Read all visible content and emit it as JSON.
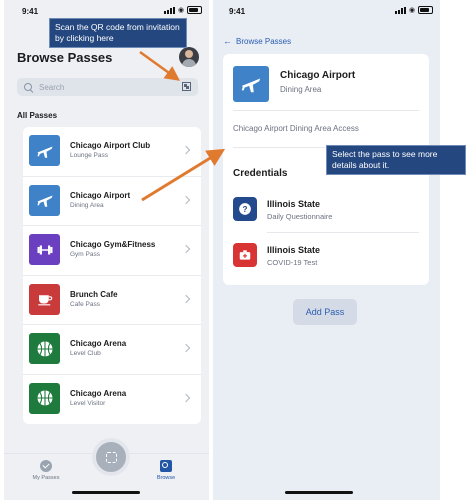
{
  "status": {
    "time": "9:41"
  },
  "annotations": {
    "scan_hint": "Scan the QR code from invitation by clicking here",
    "select_hint": "Select the pass to see more details about it."
  },
  "left": {
    "title": "Browse Passes",
    "search": {
      "placeholder": "Search"
    },
    "section_label": "All Passes",
    "passes": [
      {
        "name": "Chicago Airport Club",
        "sub": "Lounge Pass",
        "icon": "airplane-icon",
        "color": "#3f82c8"
      },
      {
        "name": "Chicago Airport",
        "sub": "Dining Area",
        "icon": "airplane-icon",
        "color": "#3f82c8"
      },
      {
        "name": "Chicago Gym&Fitness",
        "sub": "Gym Pass",
        "icon": "dumbbell-icon",
        "color": "#6a3fc0"
      },
      {
        "name": "Brunch Cafe",
        "sub": "Cafe Pass",
        "icon": "coffee-cup-icon",
        "color": "#c93a3a"
      },
      {
        "name": "Chicago Arena",
        "sub": "Level Club",
        "icon": "basketball-icon",
        "color": "#1f7a3d"
      },
      {
        "name": "Chicago Arena",
        "sub": "Level Visitor",
        "icon": "basketball-icon",
        "color": "#1f7a3d"
      }
    ],
    "tabs": {
      "my_passes": "My Passes",
      "browse": "Browse"
    }
  },
  "right": {
    "back_label": "Browse Passes",
    "detail": {
      "name": "Chicago Airport",
      "sub": "Dining Area",
      "icon": "airplane-icon",
      "color": "#3f82c8"
    },
    "access_title": "Chicago Airport Dining Area Access",
    "credentials_title": "Credentials",
    "credentials": [
      {
        "name": "Illinois State",
        "sub": "Daily Questionnaire",
        "icon": "question-icon",
        "color": "#234a8c"
      },
      {
        "name": "Illinois State",
        "sub": "COVID-19 Test",
        "icon": "medical-kit-icon",
        "color": "#d93434"
      }
    ],
    "add_pass_label": "Add Pass"
  },
  "colors": {
    "accent": "#2a5db0",
    "callout": "#24477f",
    "arrow": "#e07a2f"
  }
}
